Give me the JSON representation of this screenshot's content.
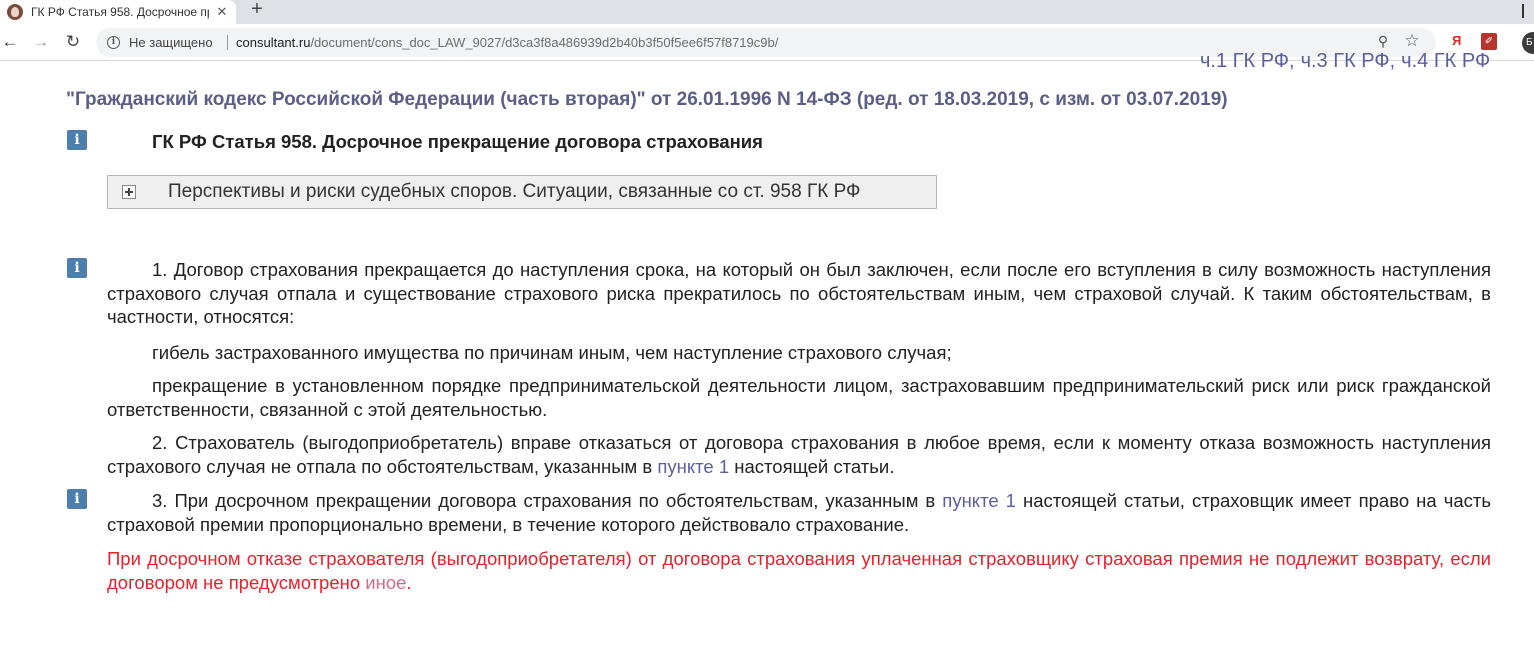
{
  "browser": {
    "tab": {
      "title": "ГК РФ Статья 958. Досрочное пр",
      "close": "✕"
    },
    "new_tab": "+",
    "security_label": "Не защищено",
    "url_host": "consultant.ru",
    "url_path": "/document/cons_doc_LAW_9027/d3ca3f8a486939d2b40b3f50f5ee6f57f8719c9b/",
    "extensions": {
      "yandex": "Я",
      "ghost": "Б"
    }
  },
  "page": {
    "clipped_links": [
      "ч.1 ГК РФ,",
      "ч.3 ГК РФ,",
      "ч.4 ГК РФ"
    ],
    "doc_title": "\"Гражданский кодекс Российской Федерации (часть вторая)\" от 26.01.1996 N 14-ФЗ (ред. от 18.03.2019, с изм. от 03.07.2019)",
    "info_icon": "i",
    "article_heading": "ГК РФ Статья 958. Досрочное прекращение договора страхования",
    "expander_label": "Перспективы и риски судебных споров. Ситуации, связанные со ст. 958 ГК РФ",
    "p1": "1. Договор страхования прекращается до наступления срока, на который он был заключен, если после его вступления в силу возможность наступления страхового случая отпала и существование страхового риска прекратилось по обстоятельствам иным, чем страховой случай. К таким обстоятельствам, в частности, относятся:",
    "p1_item1": "гибель застрахованного имущества по причинам иным, чем наступление страхового случая;",
    "p1_item2": "прекращение в установленном порядке предпринимательской деятельности лицом, застраховавшим предпринимательский риск или риск гражданской ответственности, связанной с этой деятельностью.",
    "p2_before": "2. Страхователь (выгодоприобретатель) вправе отказаться от договора страхования в любое время, если к моменту отказа возможность наступления страхового случая не отпала по обстоятельствам, указанным в ",
    "p2_link": "пункте 1",
    "p2_after": " настоящей статьи.",
    "p3_before": "3. При досрочном прекращении договора страхования по обстоятельствам, указанным в ",
    "p3_link": "пункте 1",
    "p3_after": " настоящей статьи, страховщик имеет право на часть страховой премии пропорционально времени, в течение которого действовало страхование.",
    "p4_before": "При досрочном отказе страхователя (выгодоприобретателя) от договора страхования уплаченная страховщику страховая премия не подлежит возврату, если договором не предусмотрено ",
    "p4_link": "иное",
    "p4_after": "."
  },
  "colors": {
    "link": "#5b5f9f",
    "title": "#5b5f88",
    "red_text": "#e8212b",
    "info_button": "#4d7fae"
  }
}
